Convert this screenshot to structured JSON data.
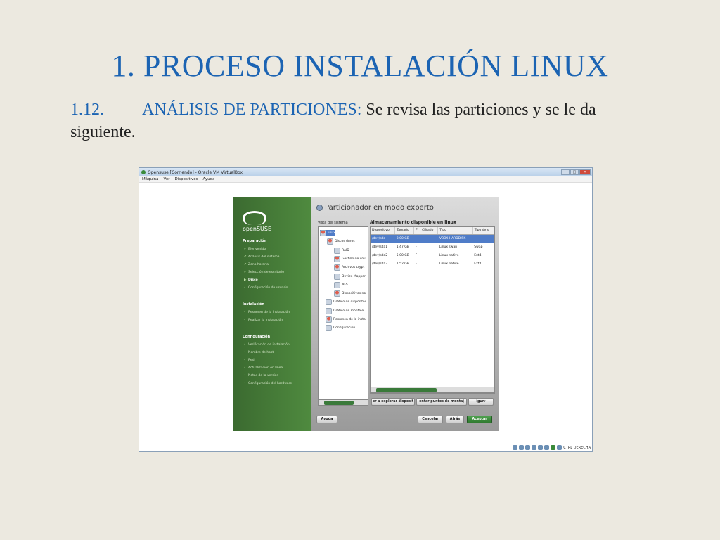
{
  "slide": {
    "title": "1. PROCESO INSTALACIÓN LINUX",
    "subtitle_number": "1.12.",
    "subtitle_label": "ANÁLISIS DE PARTICIONES:",
    "subtitle_text": " Se revisa las particiones y se le da siguiente."
  },
  "window": {
    "title": "Opensuse [Corriendo] - Oracle VM VirtualBox",
    "menu": [
      "Máquina",
      "Ver",
      "Dispositivos",
      "Ayuda"
    ],
    "status_text": "CTRL DERECHA"
  },
  "installer": {
    "logo_text": "openSUSE",
    "heading": "Particionador en modo experto",
    "system_view_label": "Vista del sistema",
    "storage_label": "Almacenamiento disponible en linux",
    "sections": [
      {
        "title": "Preparación",
        "items": [
          {
            "label": "Bienvenido",
            "state": "done"
          },
          {
            "label": "Análisis del sistema",
            "state": "done"
          },
          {
            "label": "Zona horaria",
            "state": "done"
          },
          {
            "label": "Selección de escritorio",
            "state": "done"
          },
          {
            "label": "Disco",
            "state": "active"
          },
          {
            "label": "Configuración de usuario",
            "state": "pending"
          }
        ]
      },
      {
        "title": "Instalación",
        "items": [
          {
            "label": "Resumen de la instalación",
            "state": "pending"
          },
          {
            "label": "Realizar la instalación",
            "state": "pending"
          }
        ]
      },
      {
        "title": "Configuración",
        "items": [
          {
            "label": "Verificación de instalación",
            "state": "pending"
          },
          {
            "label": "Nombre de host",
            "state": "pending"
          },
          {
            "label": "Red",
            "state": "pending"
          },
          {
            "label": "Actualización en línea",
            "state": "pending"
          },
          {
            "label": "Notas de la versión",
            "state": "pending"
          },
          {
            "label": "Configuración del hardware",
            "state": "pending"
          }
        ]
      }
    ],
    "tree": [
      "linux",
      "Discos duros",
      "RAID",
      "Gestión de volú",
      "Archivos crypt",
      "Device Mapper",
      "NFS",
      "Dispositivos no",
      "Gráfico de dispositiv",
      "Gráfico de montaje",
      "Resumen de la insta",
      "Configuración"
    ],
    "table": {
      "columns": [
        "Dispositivo",
        "Tamaño",
        "F",
        "Cifrado",
        "Tipo",
        "Tipo de s"
      ],
      "rows": [
        [
          "/dev/sda",
          "8.00 GB",
          "",
          "",
          "VBOX-HARDDISK",
          ""
        ],
        [
          "/dev/sda1",
          "1.47 GB",
          "F",
          "",
          "Linux swap",
          "Swap"
        ],
        [
          "/dev/sda2",
          "5.00 GB",
          "F",
          "",
          "Linux native",
          "Ext4"
        ],
        [
          "/dev/sda3",
          "1.52 GB",
          "F",
          "",
          "Linux native",
          "Ext4"
        ]
      ]
    },
    "buttons": {
      "explore": "er a explorar disposit",
      "mount": "entar puntos de montaj",
      "config": "igur",
      "help": "Ayuda",
      "cancel": "Cancelar",
      "back": "Atrás",
      "accept": "Aceptar"
    }
  }
}
